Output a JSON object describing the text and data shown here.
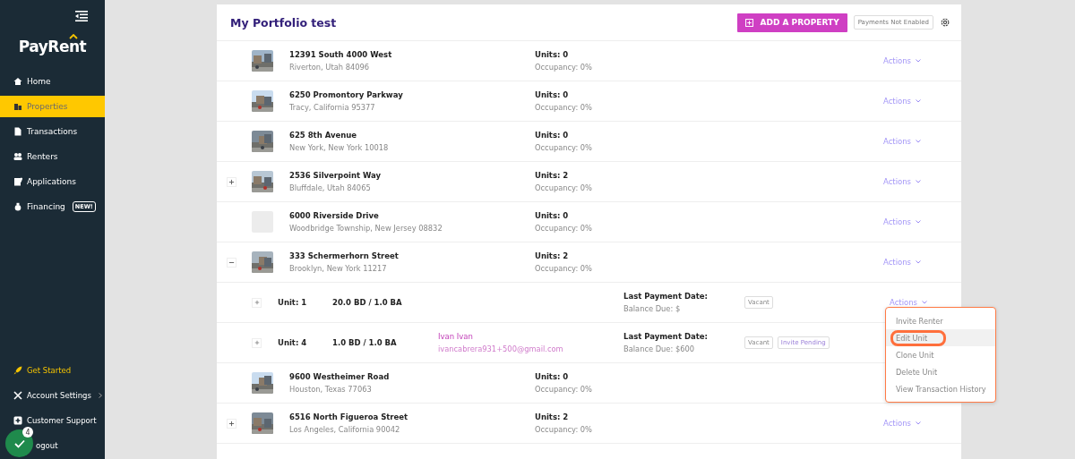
{
  "sidebar": {
    "logo": "PayRent",
    "nav": [
      {
        "label": "Home",
        "selected": false
      },
      {
        "label": "Properties",
        "selected": true
      },
      {
        "label": "Transactions",
        "selected": false
      },
      {
        "label": "Renters",
        "selected": false
      },
      {
        "label": "Applications",
        "selected": false
      },
      {
        "label": "Financing",
        "selected": false,
        "badge": "NEW!"
      }
    ],
    "footer": [
      {
        "label": "Get Started",
        "kind": "highlight"
      },
      {
        "label": "Account Settings",
        "kind": "submenu"
      },
      {
        "label": "Customer Support",
        "kind": "plain"
      },
      {
        "label": "ogout",
        "kind": "plain"
      }
    ],
    "chat_badge": {
      "count": "4"
    }
  },
  "header": {
    "title": "My Portfolio test",
    "add_button": "ADD A PROPERTY",
    "payments_status": "Payments Not Enabled"
  },
  "rows": [
    {
      "kind": "property",
      "address": "12391 South 4000 West",
      "city": "Riverton, Utah 84096",
      "units": "Units: 0",
      "occupancy": "Occupancy: 0%",
      "has_photo": true,
      "actions": "Actions"
    },
    {
      "kind": "property",
      "address": "6250 Promontory Parkway",
      "city": "Tracy, California 95377",
      "units": "Units: 0",
      "occupancy": "Occupancy: 0%",
      "has_photo": true,
      "actions": "Actions"
    },
    {
      "kind": "property",
      "address": "625 8th Avenue",
      "city": "New York, New York 10018",
      "units": "Units: 0",
      "occupancy": "Occupancy: 0%",
      "has_photo": true,
      "actions": "Actions"
    },
    {
      "kind": "property",
      "address": "2536 Silverpoint Way",
      "city": "Bluffdale, Utah 84065",
      "units": "Units: 2",
      "occupancy": "Occupancy: 0%",
      "has_photo": true,
      "expanded": false,
      "actions": "Actions"
    },
    {
      "kind": "property",
      "address": "6000 Riverside Drive",
      "city": "Woodbridge Township, New Jersey 08832",
      "units": "Units: 0",
      "occupancy": "Occupancy: 0%",
      "has_photo": false,
      "actions": "Actions"
    },
    {
      "kind": "property",
      "address": "333 Schermerhorn Street",
      "city": "Brooklyn, New York 11217",
      "units": "Units: 2",
      "occupancy": "Occupancy: 0%",
      "has_photo": true,
      "expanded": true,
      "actions": "Actions"
    },
    {
      "kind": "unit",
      "unit": "Unit: 1",
      "layout": "20.0 BD / 1.0 BA",
      "payment": "Last Payment Date:",
      "balance": "Balance Due: $",
      "badges": [
        {
          "label": "Vacant",
          "kind": "plain"
        }
      ],
      "expanded": false,
      "actions": "Actions"
    },
    {
      "kind": "unit",
      "unit": "Unit: 4",
      "layout": "1.0 BD / 1.0 BA",
      "renter": "Ivan Ivan",
      "email": "ivancabrera931+500@gmail.com",
      "payment": "Last Payment Date:",
      "balance": "Balance Due: $600",
      "badges": [
        {
          "label": "Vacant",
          "kind": "plain"
        },
        {
          "label": "Invite Pending",
          "kind": "pending"
        }
      ],
      "expanded": false
    },
    {
      "kind": "property",
      "address": "9600 Westheimer Road",
      "city": "Houston, Texas 77063",
      "units": "Units: 0",
      "occupancy": "Occupancy: 0%",
      "has_photo": true
    },
    {
      "kind": "property",
      "address": "6516 North Figueroa Street",
      "city": "Los Angeles, California 90042",
      "units": "Units: 2",
      "occupancy": "Occupancy: 0%",
      "has_photo": true,
      "expanded": false,
      "actions": "Actions"
    }
  ],
  "menu": {
    "items": [
      {
        "label": "Invite Renter",
        "selected": false
      },
      {
        "label": "Edit Unit",
        "selected": true
      },
      {
        "label": "Clone Unit",
        "selected": false
      },
      {
        "label": "Delete Unit",
        "selected": false
      },
      {
        "label": "View Transaction History",
        "selected": false
      }
    ]
  }
}
